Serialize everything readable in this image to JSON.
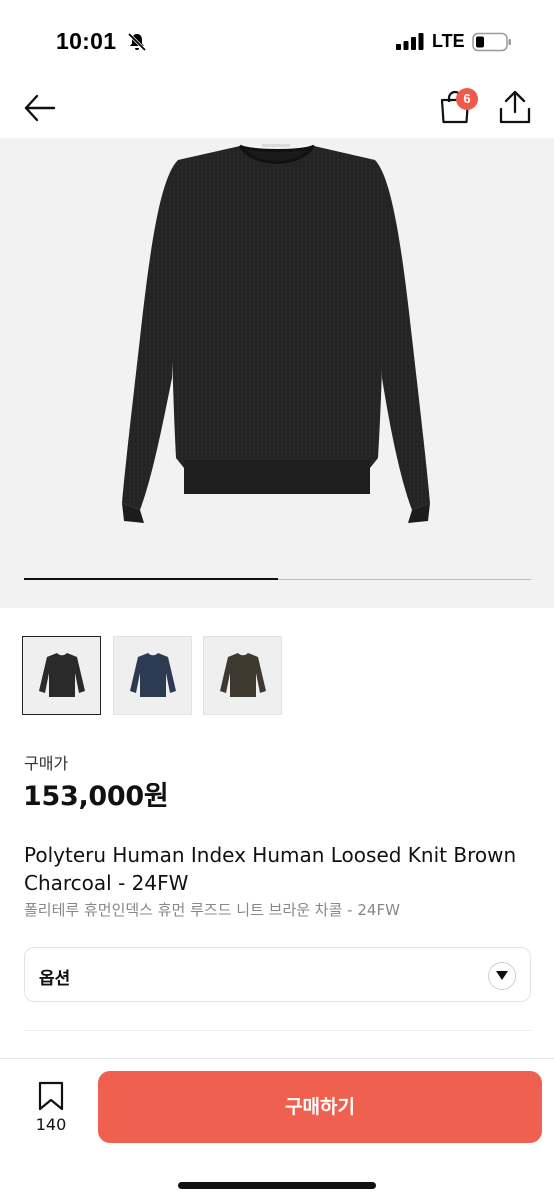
{
  "status_bar": {
    "time": "10:01",
    "network": "LTE"
  },
  "nav": {
    "cart_badge": "6"
  },
  "gallery": {
    "progress": 0.5
  },
  "product": {
    "price_label": "구매가",
    "price": "153,000원",
    "title_en": "Polyteru Human Index Human Loosed Knit Brown Charcoal - 24FW",
    "title_ko": "폴리테루 휴먼인덱스 휴먼 루즈드 니트 브라운 차콜 - 24FW"
  },
  "option": {
    "label": "옵션"
  },
  "bottom": {
    "wish_count": "140",
    "buy_label": "구매하기"
  },
  "colors": {
    "accent": "#f0604f",
    "variant_black": "#2a2a2a",
    "variant_navy": "#2c3a52",
    "variant_brown": "#3e3a30"
  },
  "icons": [
    "bell-slash-icon",
    "signal-icon",
    "battery-icon",
    "back-arrow-icon",
    "shopping-bag-icon",
    "share-icon",
    "chevron-down-icon",
    "bookmark-icon"
  ]
}
